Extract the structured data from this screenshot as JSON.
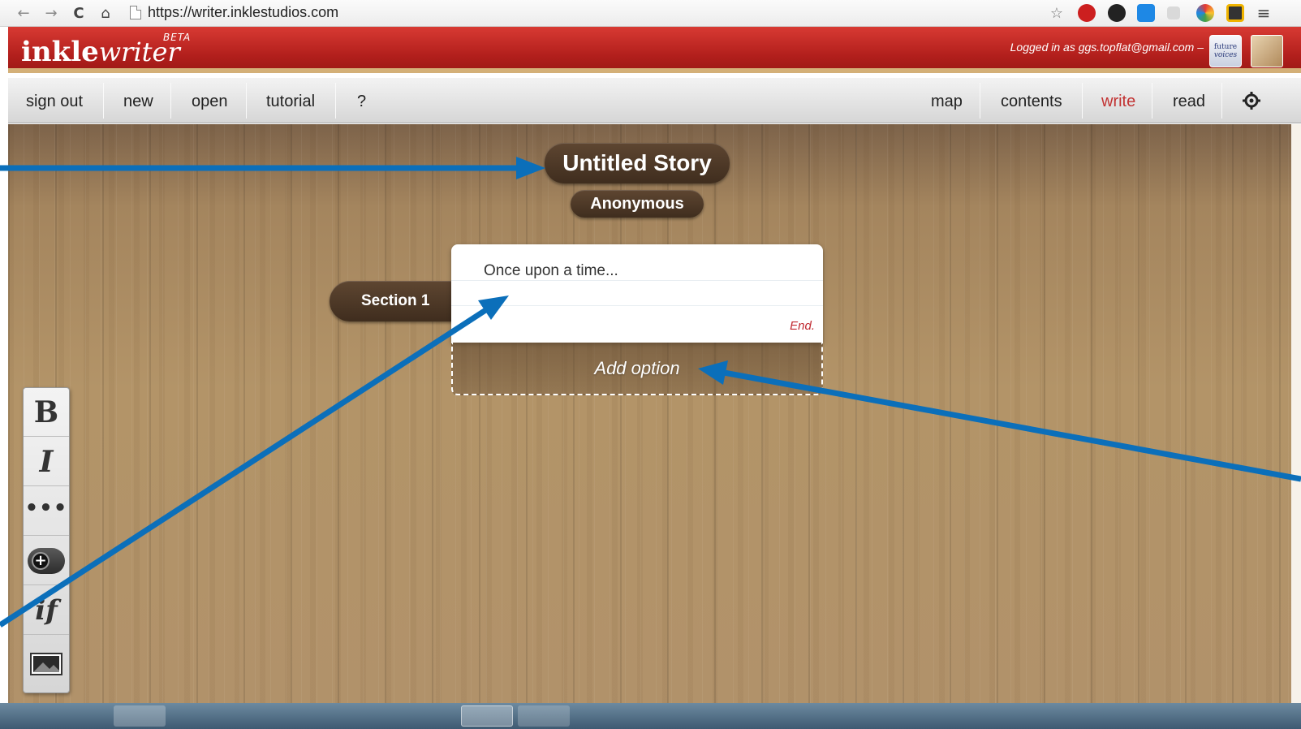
{
  "browser": {
    "url": "https://writer.inklestudios.com"
  },
  "header": {
    "logo_bold": "inkle",
    "logo_script": "writer",
    "logo_beta": "BETA",
    "login_text": "Logged in as ggs.topflat@gmail.com –",
    "badge_line1": "future",
    "badge_line2": "voices"
  },
  "toolbar": {
    "left": [
      "sign out",
      "new",
      "open",
      "tutorial",
      "?"
    ],
    "right": [
      "map",
      "contents",
      "write",
      "read"
    ],
    "active": "write"
  },
  "story": {
    "title": "Untitled Story",
    "author": "Anonymous",
    "section": "Section 1",
    "text": "Once upon a time...",
    "end_label": "End.",
    "add_option": "Add option"
  },
  "side_tools": {
    "bold": "B",
    "italic": "I",
    "dots": "•••",
    "plus": "+",
    "if": "if"
  },
  "colors": {
    "header_red": "#c22a25",
    "active_tab": "#c23232",
    "arrow_blue": "#0b6fba"
  }
}
